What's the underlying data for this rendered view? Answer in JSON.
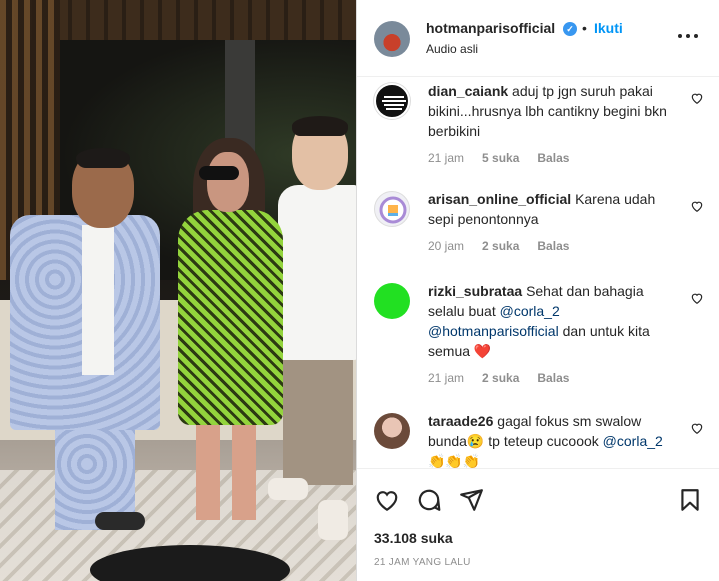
{
  "header": {
    "username": "hotmanparisofficial",
    "separator": "•",
    "follow_label": "Ikuti",
    "audio_label": "Audio asli",
    "more_icon": "more-horizontal-icon"
  },
  "comments": [
    {
      "username": "dian_caiank",
      "text": "aduj tp jgn suruh pakai bikini...hrusnya lbh cantikny begini bkn berbikini",
      "time": "21 jam",
      "likes": "5 suka",
      "reply": "Balas"
    },
    {
      "username": "arisan_online_official",
      "text": "Karena udah sepi penontonnya",
      "time": "20 jam",
      "likes": "2 suka",
      "reply": "Balas"
    },
    {
      "username": "rizki_subrataa",
      "text_before": "Sehat dan bahagia selalu buat",
      "mention1": "@corla_2",
      "mention2": "@hotmanparisofficial",
      "text_after": "dan untuk kita semua ❤️",
      "time": "21 jam",
      "likes": "2 suka",
      "reply": "Balas"
    },
    {
      "username": "taraade26",
      "text": "gagal fokus sm swalow bunda😢 tp teteup cucoook",
      "mention": "@corla_2",
      "emoji": "👏👏👏"
    }
  ],
  "footer": {
    "likes": "33.108 suka",
    "timestamp": "21 JAM YANG LALU"
  },
  "colors": {
    "accent": "#0095f6",
    "verified": "#3897f0",
    "mention": "#00376b",
    "muted": "#8e8e8e"
  }
}
